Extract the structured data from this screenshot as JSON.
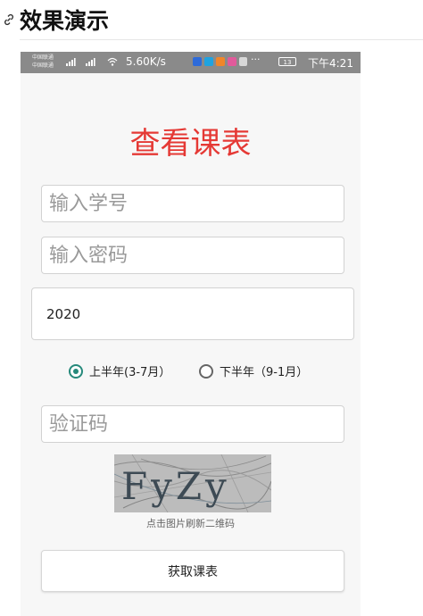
{
  "document": {
    "heading": "效果演示",
    "anchor_icon": "link-icon"
  },
  "status_bar": {
    "carrier_lines": [
      "中国联通",
      "中国联通"
    ],
    "network_speed": "5.60K/s",
    "more": "···",
    "battery": "13",
    "time": "下午4:21"
  },
  "app": {
    "title": "查看课表",
    "student_id_placeholder": "输入学号",
    "password_placeholder": "输入密码",
    "year_value": "2020",
    "semesters": [
      {
        "label": "上半年(3-7月）",
        "checked": true
      },
      {
        "label": "下半年（9-1月）",
        "checked": false
      }
    ],
    "captcha_placeholder": "验证码",
    "captcha_text": "FyZy",
    "captcha_hint": "点击图片刷新二维码",
    "submit_label": "获取课表"
  },
  "colors": {
    "title_red": "#e53935",
    "radio_accent": "#26897b",
    "status_bar_bg": "#8a8a8a"
  }
}
